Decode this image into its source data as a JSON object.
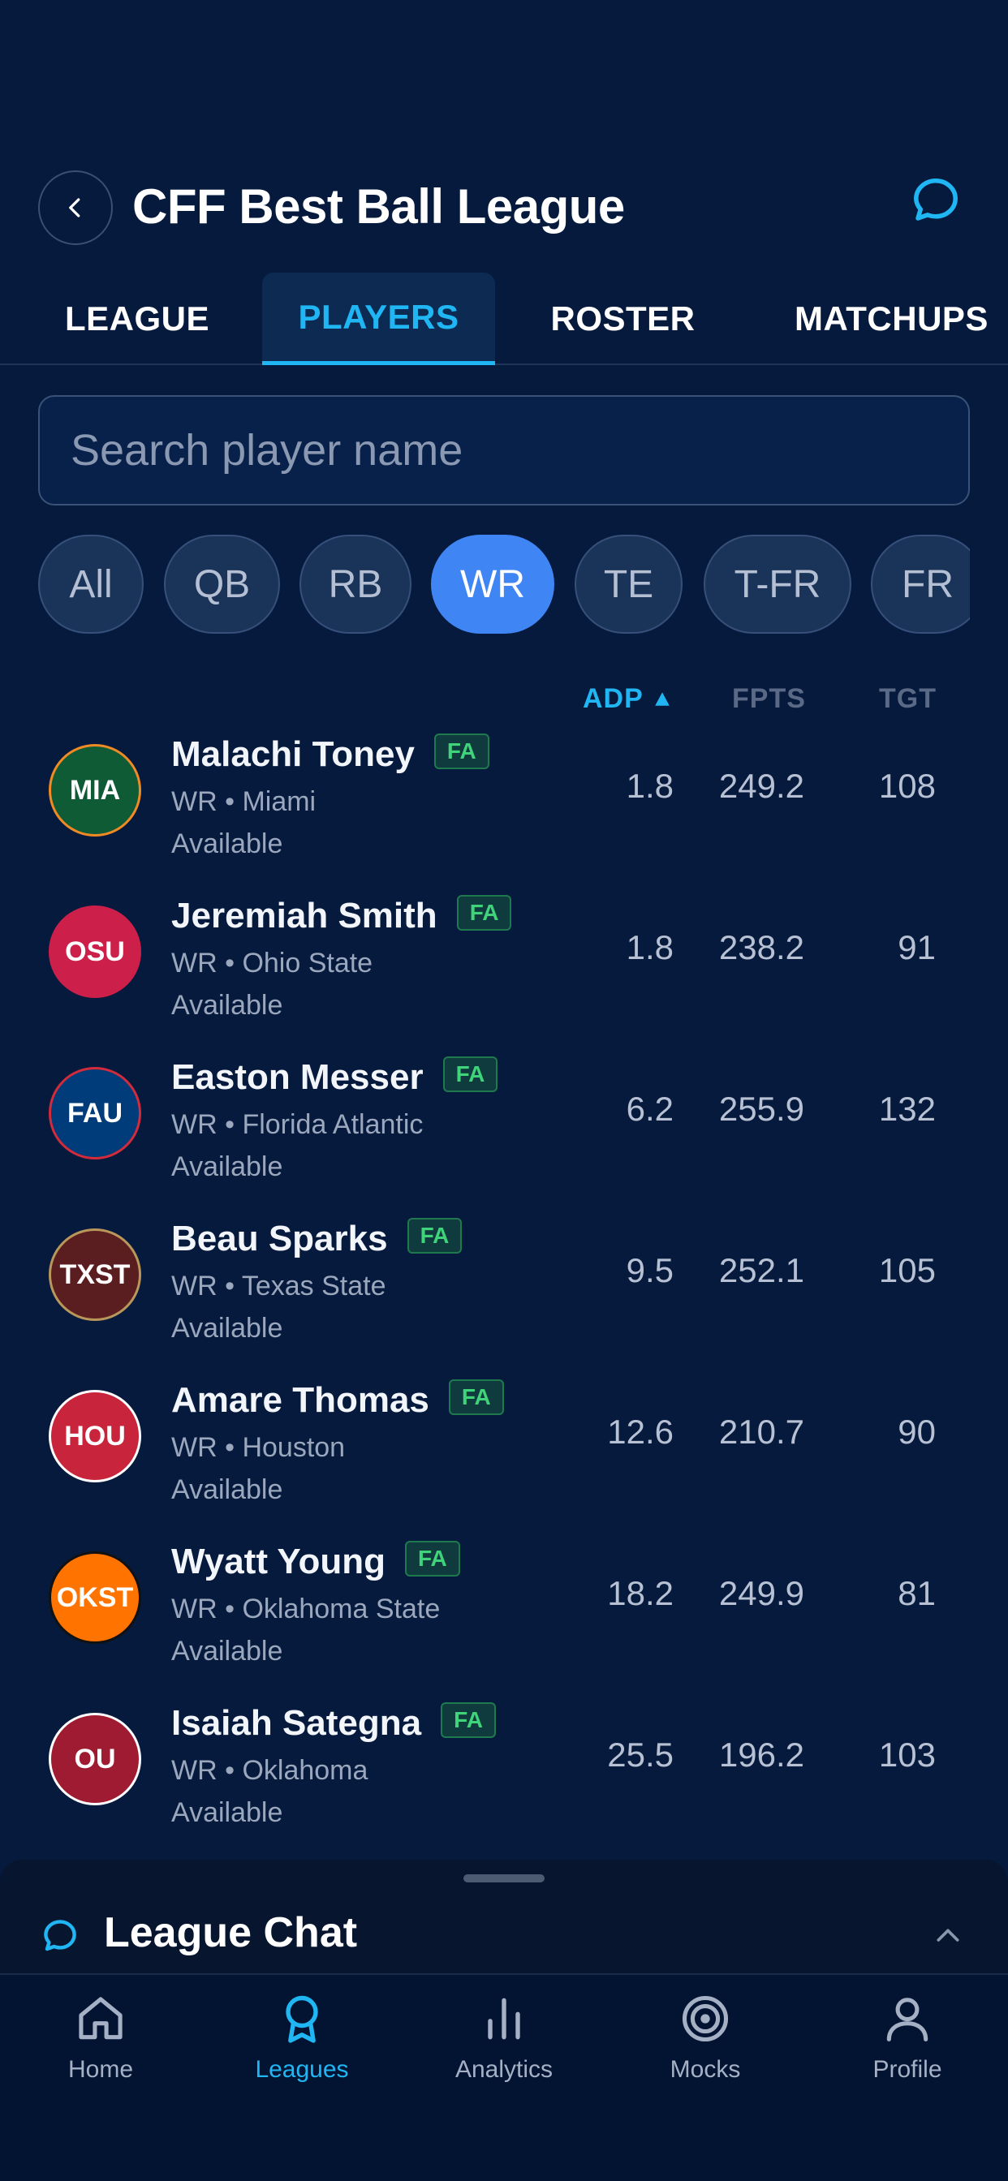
{
  "header": {
    "title": "CFF Best Ball League"
  },
  "tabs": [
    {
      "label": "LEAGUE"
    },
    {
      "label": "PLAYERS"
    },
    {
      "label": "ROSTER"
    },
    {
      "label": "MATCHUPS"
    }
  ],
  "search": {
    "placeholder": "Search player name",
    "value": ""
  },
  "positions": [
    {
      "label": "All"
    },
    {
      "label": "QB"
    },
    {
      "label": "RB"
    },
    {
      "label": "WR"
    },
    {
      "label": "TE"
    },
    {
      "label": "T-FR"
    },
    {
      "label": "FR"
    }
  ],
  "selected_position": "WR",
  "columns": {
    "adp": "ADP",
    "fpts": "FPTS",
    "tgt": "TGT",
    "sort": "ADP ascending"
  },
  "players": [
    {
      "abbr": "MIA",
      "name": "Malachi Toney",
      "badge": "FA",
      "info": "WR • Miami",
      "status": "Available",
      "adp": "1.8",
      "fpts": "249.2",
      "tgt": "108",
      "logo_bg": "#0f5b36",
      "logo_border": "#f08a24"
    },
    {
      "abbr": "OSU",
      "name": "Jeremiah Smith",
      "badge": "FA",
      "info": "WR • Ohio State",
      "status": "Available",
      "adp": "1.8",
      "fpts": "238.2",
      "tgt": "91",
      "logo_bg": "#cc1f4a",
      "logo_border": "#cc1f4a"
    },
    {
      "abbr": "FAU",
      "name": "Easton Messer",
      "badge": "FA",
      "info": "WR • Florida Atlantic",
      "status": "Available",
      "adp": "6.2",
      "fpts": "255.9",
      "tgt": "132",
      "logo_bg": "#003b7a",
      "logo_border": "#d12b3c"
    },
    {
      "abbr": "TXST",
      "name": "Beau Sparks",
      "badge": "FA",
      "info": "WR • Texas State",
      "status": "Available",
      "adp": "9.5",
      "fpts": "252.1",
      "tgt": "105",
      "logo_bg": "#5a1e20",
      "logo_border": "#b9975b"
    },
    {
      "abbr": "HOU",
      "name": "Amare Thomas",
      "badge": "FA",
      "info": "WR • Houston",
      "status": "Available",
      "adp": "12.6",
      "fpts": "210.7",
      "tgt": "90",
      "logo_bg": "#c8253d",
      "logo_border": "#ffffff"
    },
    {
      "abbr": "OKST",
      "name": "Wyatt Young",
      "badge": "FA",
      "info": "WR • Oklahoma State",
      "status": "Available",
      "adp": "18.2",
      "fpts": "249.9",
      "tgt": "81",
      "logo_bg": "#ff7300",
      "logo_border": "#111111"
    },
    {
      "abbr": "OU",
      "name": "Isaiah Sategna",
      "badge": "FA",
      "info": "WR • Oklahoma",
      "status": "Available",
      "adp": "25.5",
      "fpts": "196.2",
      "tgt": "103",
      "logo_bg": "#9e1b32",
      "logo_border": "#ffffff"
    }
  ],
  "chat": {
    "title": "League Chat"
  },
  "nav": [
    {
      "label": "Home",
      "icon": "home-icon"
    },
    {
      "label": "Leagues",
      "icon": "award-icon"
    },
    {
      "label": "Analytics",
      "icon": "bar-chart-icon"
    },
    {
      "label": "Mocks",
      "icon": "target-icon"
    },
    {
      "label": "Profile",
      "icon": "user-icon"
    }
  ],
  "active_nav": "Leagues",
  "colors": {
    "accent": "#1fb6f3",
    "chip_active": "#3f86f4",
    "background": "#061a3d",
    "fa_badge": "#3fd37a"
  }
}
